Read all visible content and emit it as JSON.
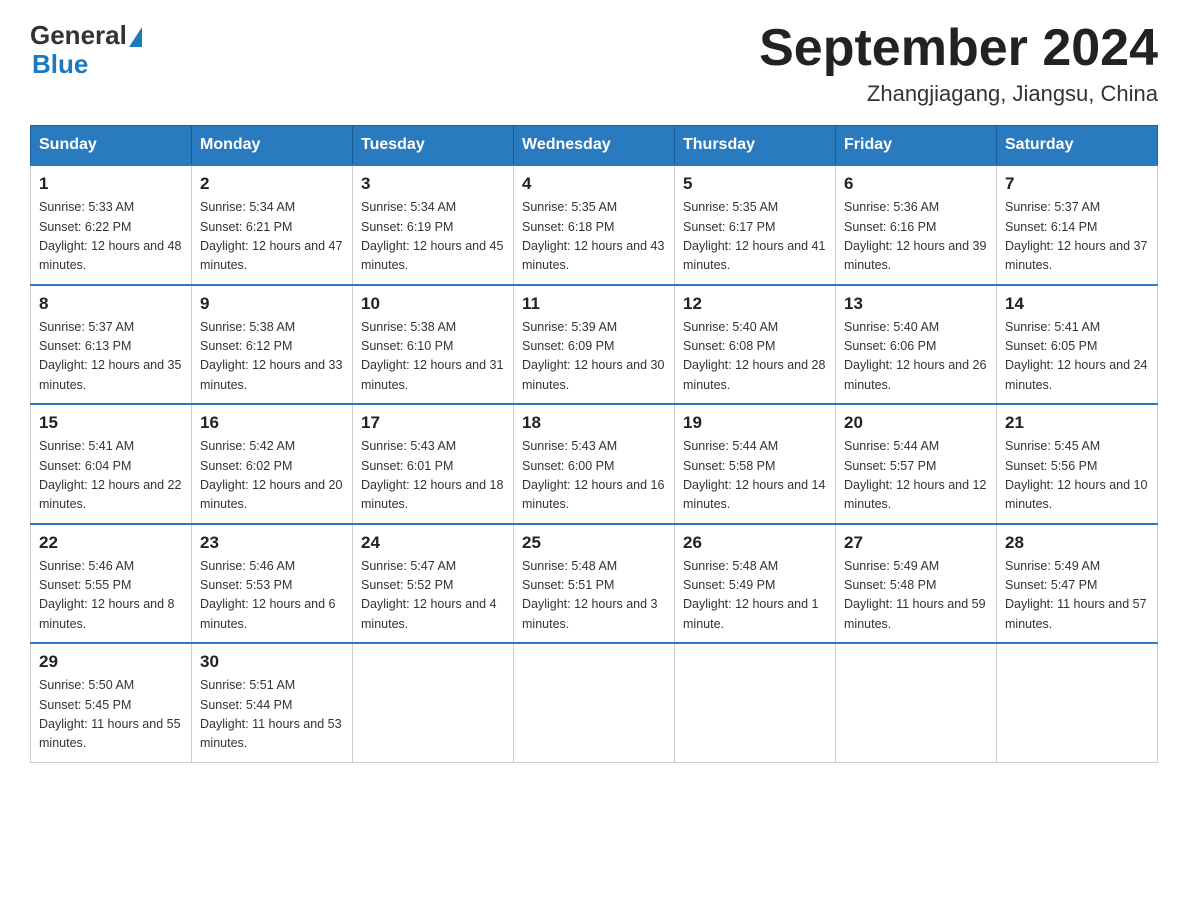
{
  "header": {
    "logo_general": "General",
    "logo_blue": "Blue",
    "title": "September 2024",
    "subtitle": "Zhangjiagang, Jiangsu, China"
  },
  "weekdays": [
    "Sunday",
    "Monday",
    "Tuesday",
    "Wednesday",
    "Thursday",
    "Friday",
    "Saturday"
  ],
  "weeks": [
    [
      {
        "day": "1",
        "sunrise": "5:33 AM",
        "sunset": "6:22 PM",
        "daylight": "12 hours and 48 minutes."
      },
      {
        "day": "2",
        "sunrise": "5:34 AM",
        "sunset": "6:21 PM",
        "daylight": "12 hours and 47 minutes."
      },
      {
        "day": "3",
        "sunrise": "5:34 AM",
        "sunset": "6:19 PM",
        "daylight": "12 hours and 45 minutes."
      },
      {
        "day": "4",
        "sunrise": "5:35 AM",
        "sunset": "6:18 PM",
        "daylight": "12 hours and 43 minutes."
      },
      {
        "day": "5",
        "sunrise": "5:35 AM",
        "sunset": "6:17 PM",
        "daylight": "12 hours and 41 minutes."
      },
      {
        "day": "6",
        "sunrise": "5:36 AM",
        "sunset": "6:16 PM",
        "daylight": "12 hours and 39 minutes."
      },
      {
        "day": "7",
        "sunrise": "5:37 AM",
        "sunset": "6:14 PM",
        "daylight": "12 hours and 37 minutes."
      }
    ],
    [
      {
        "day": "8",
        "sunrise": "5:37 AM",
        "sunset": "6:13 PM",
        "daylight": "12 hours and 35 minutes."
      },
      {
        "day": "9",
        "sunrise": "5:38 AM",
        "sunset": "6:12 PM",
        "daylight": "12 hours and 33 minutes."
      },
      {
        "day": "10",
        "sunrise": "5:38 AM",
        "sunset": "6:10 PM",
        "daylight": "12 hours and 31 minutes."
      },
      {
        "day": "11",
        "sunrise": "5:39 AM",
        "sunset": "6:09 PM",
        "daylight": "12 hours and 30 minutes."
      },
      {
        "day": "12",
        "sunrise": "5:40 AM",
        "sunset": "6:08 PM",
        "daylight": "12 hours and 28 minutes."
      },
      {
        "day": "13",
        "sunrise": "5:40 AM",
        "sunset": "6:06 PM",
        "daylight": "12 hours and 26 minutes."
      },
      {
        "day": "14",
        "sunrise": "5:41 AM",
        "sunset": "6:05 PM",
        "daylight": "12 hours and 24 minutes."
      }
    ],
    [
      {
        "day": "15",
        "sunrise": "5:41 AM",
        "sunset": "6:04 PM",
        "daylight": "12 hours and 22 minutes."
      },
      {
        "day": "16",
        "sunrise": "5:42 AM",
        "sunset": "6:02 PM",
        "daylight": "12 hours and 20 minutes."
      },
      {
        "day": "17",
        "sunrise": "5:43 AM",
        "sunset": "6:01 PM",
        "daylight": "12 hours and 18 minutes."
      },
      {
        "day": "18",
        "sunrise": "5:43 AM",
        "sunset": "6:00 PM",
        "daylight": "12 hours and 16 minutes."
      },
      {
        "day": "19",
        "sunrise": "5:44 AM",
        "sunset": "5:58 PM",
        "daylight": "12 hours and 14 minutes."
      },
      {
        "day": "20",
        "sunrise": "5:44 AM",
        "sunset": "5:57 PM",
        "daylight": "12 hours and 12 minutes."
      },
      {
        "day": "21",
        "sunrise": "5:45 AM",
        "sunset": "5:56 PM",
        "daylight": "12 hours and 10 minutes."
      }
    ],
    [
      {
        "day": "22",
        "sunrise": "5:46 AM",
        "sunset": "5:55 PM",
        "daylight": "12 hours and 8 minutes."
      },
      {
        "day": "23",
        "sunrise": "5:46 AM",
        "sunset": "5:53 PM",
        "daylight": "12 hours and 6 minutes."
      },
      {
        "day": "24",
        "sunrise": "5:47 AM",
        "sunset": "5:52 PM",
        "daylight": "12 hours and 4 minutes."
      },
      {
        "day": "25",
        "sunrise": "5:48 AM",
        "sunset": "5:51 PM",
        "daylight": "12 hours and 3 minutes."
      },
      {
        "day": "26",
        "sunrise": "5:48 AM",
        "sunset": "5:49 PM",
        "daylight": "12 hours and 1 minute."
      },
      {
        "day": "27",
        "sunrise": "5:49 AM",
        "sunset": "5:48 PM",
        "daylight": "11 hours and 59 minutes."
      },
      {
        "day": "28",
        "sunrise": "5:49 AM",
        "sunset": "5:47 PM",
        "daylight": "11 hours and 57 minutes."
      }
    ],
    [
      {
        "day": "29",
        "sunrise": "5:50 AM",
        "sunset": "5:45 PM",
        "daylight": "11 hours and 55 minutes."
      },
      {
        "day": "30",
        "sunrise": "5:51 AM",
        "sunset": "5:44 PM",
        "daylight": "11 hours and 53 minutes."
      },
      null,
      null,
      null,
      null,
      null
    ]
  ]
}
